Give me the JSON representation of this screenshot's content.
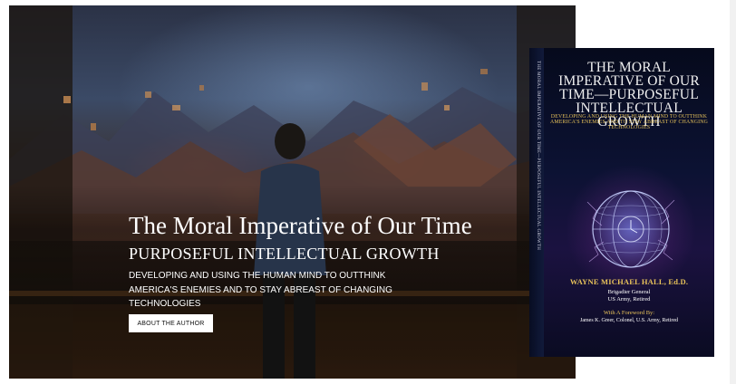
{
  "hero": {
    "title": "The Moral Imperative of Our Time",
    "subtitle": "PURPOSEFUL INTELLECTUAL GROWTH",
    "description": "DEVELOPING AND USING THE HUMAN MIND TO OUTTHINK AMERICA'S ENEMIES AND TO STAY ABREAST OF CHANGING TECHNOLOGIES",
    "button_label": "ABOUT THE AUTHOR"
  },
  "book": {
    "title": "THE MORAL IMPERATIVE OF OUR TIME—PURPOSEFUL INTELLECTUAL GROWTH",
    "tagline": "DEVELOPING AND USING THE HUMAN MIND TO OUTTHINK AMERICA'S ENEMIES AND TO STAY ABREAST OF CHANGING TECHNOLOGIES",
    "author": "WAYNE MICHAEL HALL, Ed.D.",
    "rank": "Brigadier General",
    "service": "US Army, Retired",
    "foreword_label": "With A Foreword By:",
    "foreword_by": "James K. Greer, Colonel, U.S. Army, Retired",
    "spine_text": "THE MORAL IMPERATIVE OF OUR TIME—PURPOSEFUL INTELLECTUAL GROWTH"
  },
  "colors": {
    "accent_gold": "#e7c25a",
    "button_bg": "#ffffff",
    "cover_bg": "#0c1233"
  }
}
